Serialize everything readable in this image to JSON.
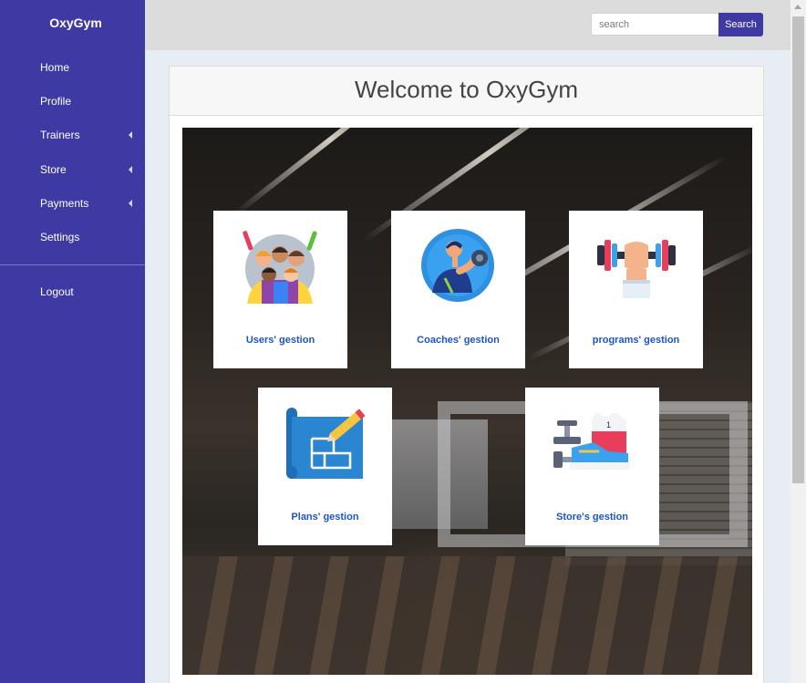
{
  "app": {
    "brand": "OxyGym"
  },
  "sidebar": {
    "items": [
      {
        "label": "Home",
        "has_submenu": false
      },
      {
        "label": "Profile",
        "has_submenu": false
      },
      {
        "label": "Trainers",
        "has_submenu": true
      },
      {
        "label": "Store",
        "has_submenu": true
      },
      {
        "label": "Payments",
        "has_submenu": true
      },
      {
        "label": "Settings",
        "has_submenu": false
      }
    ],
    "logout": "Logout"
  },
  "search": {
    "placeholder": "search",
    "value": "",
    "button_label": "Search"
  },
  "main": {
    "title": "Welcome to OxyGym"
  },
  "tiles": [
    {
      "label": "Users' gestion",
      "icon": "users-group-icon"
    },
    {
      "label": "Coaches' gestion",
      "icon": "coach-dumbbell-icon"
    },
    {
      "label": "programs' gestion",
      "icon": "lifting-dumbbell-icon"
    },
    {
      "label": "Plans' gestion",
      "icon": "blueprint-pencil-icon"
    },
    {
      "label": "Store's gestion",
      "icon": "store-sport-items-icon"
    }
  ],
  "colors": {
    "sidebar_bg": "#3f3aa3",
    "accent": "#3f3aa3",
    "tile_label": "#1f54c4",
    "topbar_bg": "#dcdcdc"
  }
}
